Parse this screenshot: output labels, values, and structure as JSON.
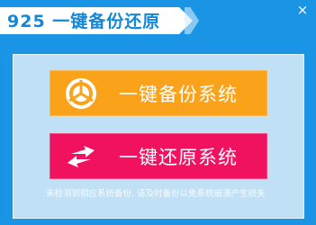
{
  "window": {
    "title": "925 一键备份还原",
    "close_label": "×"
  },
  "actions": {
    "backup_label": "一键备份系统",
    "restore_label": "一键还原系统"
  },
  "hint": {
    "text": "未检测到相应系统备份, 请及时备份以免系统崩溃产生损失"
  },
  "colors": {
    "window_bg": "#1a95e5",
    "panel_bg": "#bfe0f5",
    "backup_button": "#fba21b",
    "restore_button": "#f0125e",
    "title_text": "#1487d8"
  },
  "icons": {
    "backup": "pie-segments-icon",
    "restore": "swap-arrows-icon",
    "close": "close-icon"
  }
}
